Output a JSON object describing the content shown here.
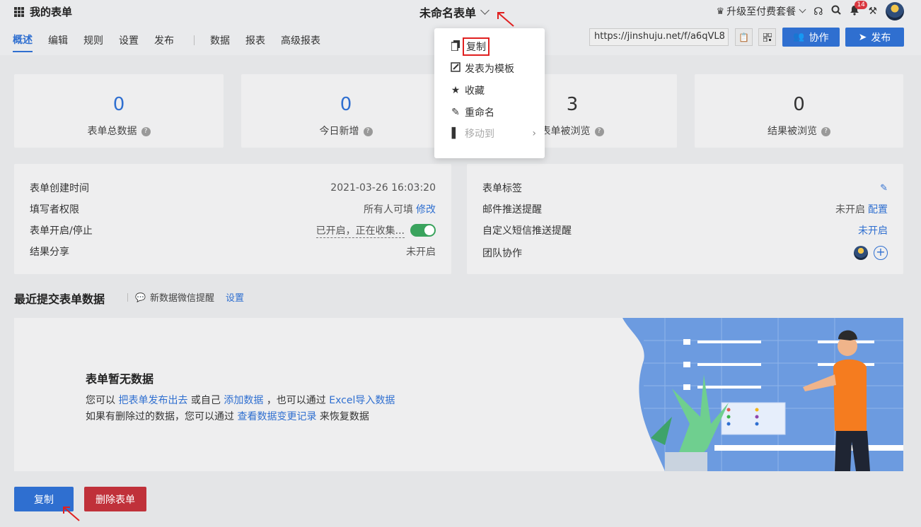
{
  "header": {
    "app_title": "我的表单",
    "form_title": "未命名表单",
    "upgrade_label": "升级至付费套餐",
    "notification_count": "14"
  },
  "tabs": [
    {
      "label": "概述",
      "active": true
    },
    {
      "label": "编辑"
    },
    {
      "label": "规则"
    },
    {
      "label": "设置"
    },
    {
      "label": "发布"
    },
    {
      "label": "数据"
    },
    {
      "label": "报表"
    },
    {
      "label": "高级报表"
    }
  ],
  "share": {
    "url": "https://jinshuju.net/f/a6qVL8",
    "collaborate_label": "协作",
    "publish_label": "发布"
  },
  "dropdown": {
    "items": [
      {
        "label": "复制",
        "icon": "copy-icon"
      },
      {
        "label": "发表为模板",
        "icon": "template-icon"
      },
      {
        "label": "收藏",
        "icon": "star-icon"
      },
      {
        "label": "重命名",
        "icon": "pencil-icon"
      },
      {
        "label": "移动到",
        "icon": "folder-icon",
        "disabled": true
      }
    ]
  },
  "stats": [
    {
      "value": "0",
      "label": "表单总数据"
    },
    {
      "value": "0",
      "label": "今日新增"
    },
    {
      "value": "3",
      "label": "表单被浏览"
    },
    {
      "value": "0",
      "label": "结果被浏览"
    }
  ],
  "info_left": {
    "created_label": "表单创建时间",
    "created_value": "2021-03-26 16:03:20",
    "permission_label": "填写者权限",
    "permission_value": "所有人可填",
    "permission_link": "修改",
    "open_label": "表单开启/停止",
    "open_value": "已开启，正在收集...",
    "share_label": "结果分享",
    "share_value": "未开启"
  },
  "info_right": {
    "tags_label": "表单标签",
    "email_label": "邮件推送提醒",
    "email_value": "未开启",
    "email_link": "配置",
    "sms_label": "自定义短信推送提醒",
    "sms_value": "未开启",
    "team_label": "团队协作"
  },
  "recent": {
    "title": "最近提交表单数据",
    "wechat_label": "新数据微信提醒",
    "settings_link": "设置"
  },
  "empty_state": {
    "title": "表单暂无数据",
    "line1_a": "您可以",
    "line1_link1": "把表单发布出去",
    "line1_b": "或自己",
    "line1_link2": "添加数据",
    "line1_c": "，也可以通过",
    "line1_link3": "Excel导入数据",
    "line2_a": "如果有删除过的数据，您可以通过",
    "line2_link": "查看数据变更记录",
    "line2_b": "来恢复数据"
  },
  "actions": {
    "copy_label": "复制",
    "delete_label": "删除表单"
  },
  "colors": {
    "accent": "#2f6fd0",
    "danger": "#c0313a",
    "toggle_on": "#3aa35d",
    "annotation": "#e02020"
  }
}
